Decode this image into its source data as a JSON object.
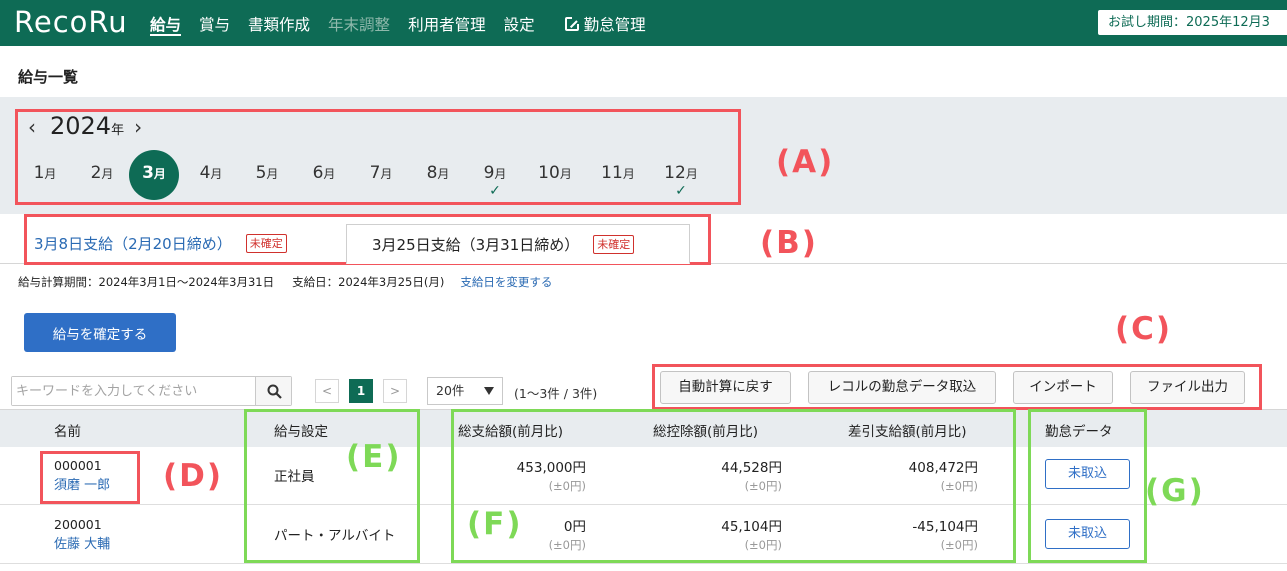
{
  "app": {
    "logo_text": "RecoRu",
    "nav": [
      {
        "label": "給与",
        "active": true
      },
      {
        "label": "賞与"
      },
      {
        "label": "書類作成"
      },
      {
        "label": "年末調整",
        "disabled": true
      },
      {
        "label": "利用者管理"
      },
      {
        "label": "設定"
      },
      {
        "label": "勤怠管理",
        "icon": "external-link-icon"
      }
    ],
    "trial_text": "お試し期間：2025年12月3"
  },
  "page_title": "給与一覧",
  "calendar": {
    "year": "2024",
    "year_unit": "年",
    "month_unit": "月",
    "months": [
      "1",
      "2",
      "3",
      "4",
      "5",
      "6",
      "7",
      "8",
      "9",
      "10",
      "11",
      "12"
    ],
    "selected_month": "3",
    "checked_months": [
      "9",
      "12"
    ]
  },
  "tabs": [
    {
      "label": "3月8日支給（2月20日締め）",
      "badge": "未確定",
      "active": false
    },
    {
      "label": "3月25日支給（3月31日締め）",
      "badge": "未確定",
      "active": true
    }
  ],
  "period": {
    "calc_period": "給与計算期間：2024年3月1日〜2024年3月31日",
    "pay_day": "支給日：2024年3月25日(月)",
    "change_link": "支給日を変更する"
  },
  "confirm_button": "給与を確定する",
  "search": {
    "placeholder": "キーワードを入力してください"
  },
  "pagination": {
    "prev": "<",
    "current": "1",
    "next": ">",
    "per_page": "20件",
    "count": "(1〜3件 / 3件)"
  },
  "actions": [
    "自動計算に戻す",
    "レコルの勤怠データ取込",
    "インポート",
    "ファイル出力"
  ],
  "table": {
    "headers": {
      "name": "名前",
      "setting": "給与設定",
      "gross": "総支給額(前月比)",
      "deduction": "総控除額(前月比)",
      "net": "差引支給額(前月比)",
      "attendance": "勤怠データ"
    },
    "rows": [
      {
        "id": "000001",
        "name": "須磨 一郎",
        "setting": "正社員",
        "gross": "453,000円",
        "gross_diff": "(±0円)",
        "deduction": "44,528円",
        "deduction_diff": "(±0円)",
        "net": "408,472円",
        "net_diff": "(±0円)",
        "attendance": "未取込"
      },
      {
        "id": "200001",
        "name": "佐藤 大輔",
        "setting": "パート・アルバイト",
        "gross": "0円",
        "gross_diff": "(±0円)",
        "deduction": "45,104円",
        "deduction_diff": "(±0円)",
        "net": "-45,104円",
        "net_diff": "(±0円)",
        "attendance": "未取込"
      }
    ]
  },
  "annotations": {
    "A": "(A)",
    "B": "(B)",
    "C": "(C)",
    "D": "(D)",
    "E": "(E)",
    "F": "(F)",
    "G": "(G)"
  },
  "colors": {
    "brand": "#0e6b55",
    "link": "#2a6ab3",
    "primary_button": "#2f6fc6",
    "annotation_red": "#f2545b",
    "annotation_green": "#7ed957"
  }
}
